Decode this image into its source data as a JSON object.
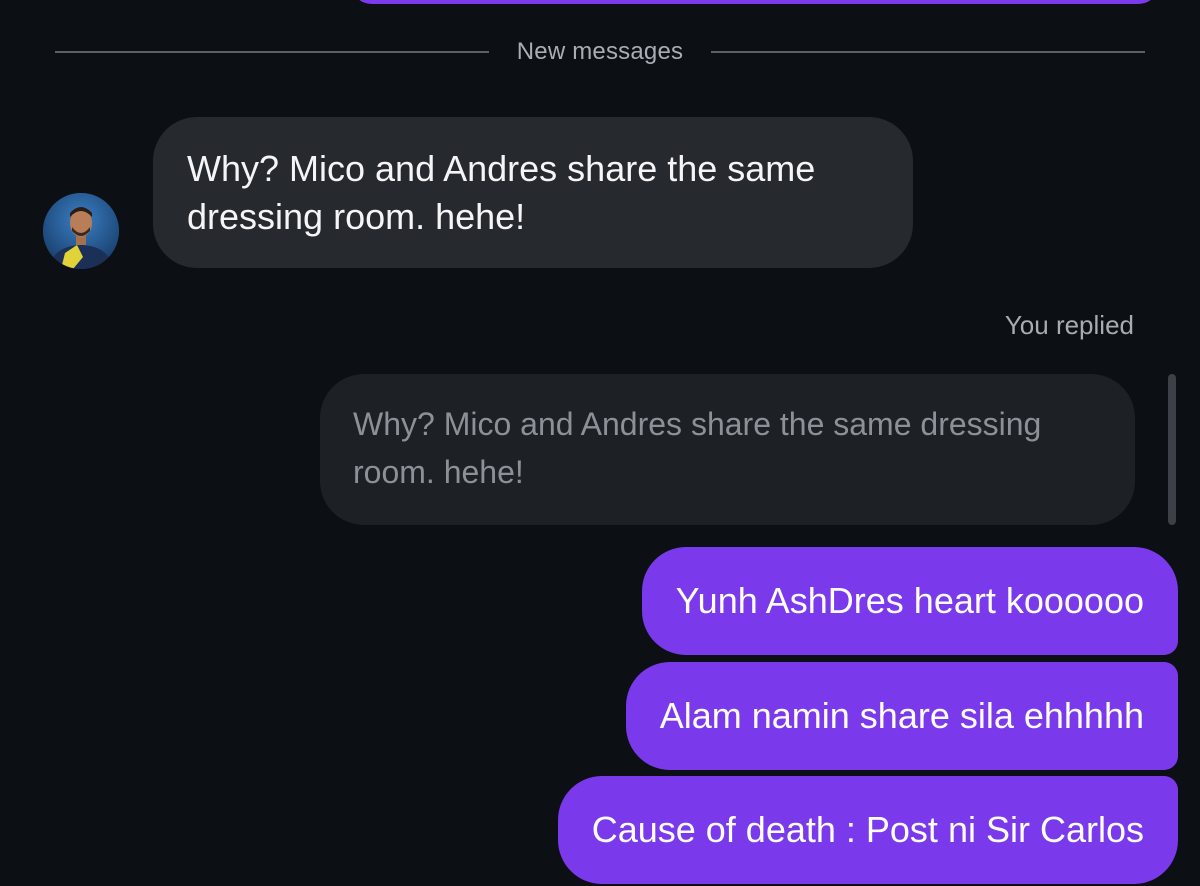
{
  "divider": {
    "label": "New messages"
  },
  "incoming_message": {
    "text": "Why? Mico and Andres share the same dressing room. hehe!"
  },
  "reply": {
    "label": "You replied",
    "quoted_text": "Why? Mico and Andres share the same dressing room. hehe!"
  },
  "outgoing_messages": [
    {
      "text": "Yunh AshDres heart koooooo"
    },
    {
      "text": "Alam namin share sila ehhhhh"
    },
    {
      "text": "Cause of death : Post ni Sir Carlos"
    }
  ],
  "colors": {
    "background": "#0c0f13",
    "incoming_bubble": "#26292e",
    "quoted_bubble": "#1d2024",
    "outgoing_bubble": "#7a3aec",
    "divider_line": "#5b5f66"
  }
}
